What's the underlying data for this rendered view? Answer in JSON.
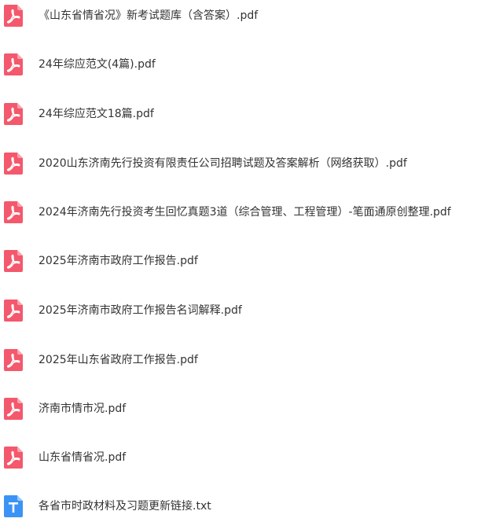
{
  "colors": {
    "pdf_icon": "#f4586c",
    "txt_icon": "#3b93f5",
    "text": "#333333"
  },
  "files": [
    {
      "name": "《山东省情省况》新考试题库（含答案）.pdf",
      "icon": "pdf-icon"
    },
    {
      "name": "24年综应范文(4篇).pdf",
      "icon": "pdf-icon"
    },
    {
      "name": "24年综应范文18篇.pdf",
      "icon": "pdf-icon"
    },
    {
      "name": "2020山东济南先行投资有限责任公司招聘试题及答案解析（网络获取）.pdf",
      "icon": "pdf-icon"
    },
    {
      "name": "2024年济南先行投资考生回忆真题3道（综合管理、工程管理）-笔面通原创整理.pdf",
      "icon": "pdf-icon"
    },
    {
      "name": "2025年济南市政府工作报告.pdf",
      "icon": "pdf-icon"
    },
    {
      "name": "2025年济南市政府工作报告名词解释.pdf",
      "icon": "pdf-icon"
    },
    {
      "name": "2025年山东省政府工作报告.pdf",
      "icon": "pdf-icon"
    },
    {
      "name": "济南市情市况.pdf",
      "icon": "pdf-icon"
    },
    {
      "name": "山东省情省况.pdf",
      "icon": "pdf-icon"
    },
    {
      "name": "各省市时政材料及习题更新链接.txt",
      "icon": "txt-icon"
    }
  ]
}
